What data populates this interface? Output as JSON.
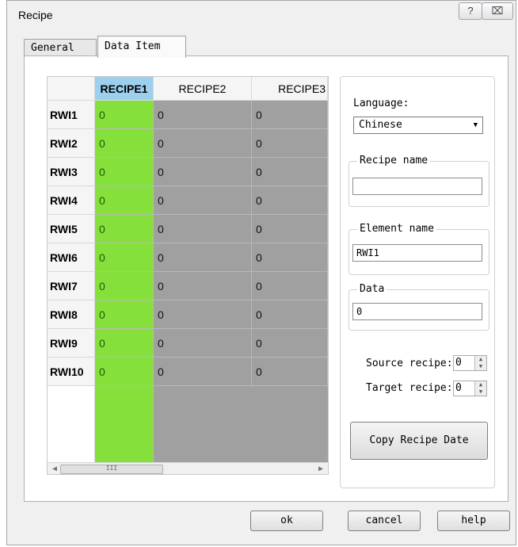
{
  "window": {
    "title": "Recipe",
    "help_glyph": "?",
    "close_glyph": "⌧"
  },
  "tabs": [
    {
      "label": "General"
    },
    {
      "label": "Data Item"
    }
  ],
  "grid": {
    "columns": [
      "RECIPE1",
      "RECIPE2",
      "RECIPE3"
    ],
    "rows": [
      {
        "name": "RWI1",
        "values": [
          "0",
          "0",
          "0"
        ]
      },
      {
        "name": "RWI2",
        "values": [
          "0",
          "0",
          "0"
        ]
      },
      {
        "name": "RWI3",
        "values": [
          "0",
          "0",
          "0"
        ]
      },
      {
        "name": "RWI4",
        "values": [
          "0",
          "0",
          "0"
        ]
      },
      {
        "name": "RWI5",
        "values": [
          "0",
          "0",
          "0"
        ]
      },
      {
        "name": "RWI6",
        "values": [
          "0",
          "0",
          "0"
        ]
      },
      {
        "name": "RWI7",
        "values": [
          "0",
          "0",
          "0"
        ]
      },
      {
        "name": "RWI8",
        "values": [
          "0",
          "0",
          "0"
        ]
      },
      {
        "name": "RWI9",
        "values": [
          "0",
          "0",
          "0"
        ]
      },
      {
        "name": "RWI10",
        "values": [
          "0",
          "0",
          "0"
        ]
      }
    ],
    "scroll_left_glyph": "◀",
    "scroll_right_glyph": "▶",
    "scroll_thumb_grip": "III"
  },
  "side": {
    "language_label": "Language:",
    "language_value": "Chinese",
    "recipe_name_title": "Recipe name",
    "recipe_name_value": "",
    "element_name_title": "Element name",
    "element_name_value": "RWI1",
    "data_title": "Data",
    "data_value": "0",
    "source_recipe_label": "Source recipe:",
    "source_recipe_value": "0",
    "target_recipe_label": "Target recipe:",
    "target_recipe_value": "0",
    "copy_button": "Copy Recipe Date"
  },
  "buttons": {
    "ok": "ok",
    "cancel": "cancel",
    "help": "help"
  },
  "colors": {
    "selected_column": "#86e03c",
    "header_selected": "#9cd0ee",
    "grid_background": "#a0a0a0"
  }
}
